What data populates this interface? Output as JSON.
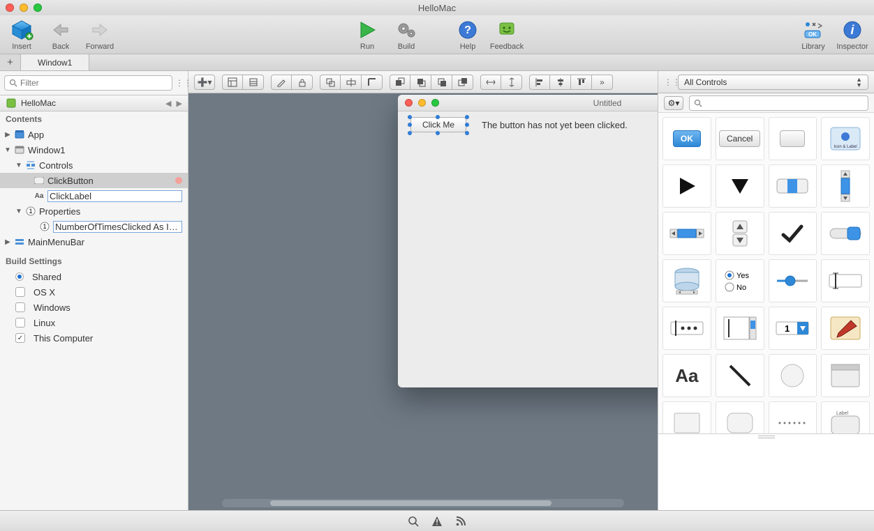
{
  "window": {
    "title": "HelloMac"
  },
  "toolbar": {
    "insert": "Insert",
    "back": "Back",
    "forward": "Forward",
    "run": "Run",
    "build": "Build",
    "help": "Help",
    "feedback": "Feedback",
    "library": "Library",
    "inspector": "Inspector"
  },
  "tabs": {
    "active": "Window1"
  },
  "navigator": {
    "filter_placeholder": "Filter",
    "project": "HelloMac",
    "contents_label": "Contents",
    "tree": {
      "app": "App",
      "window1": "Window1",
      "controls": "Controls",
      "click_button": "ClickButton",
      "click_label": "ClickLabel",
      "properties": "Properties",
      "prop1": "NumberOfTimesClicked As In...",
      "mainmenubar": "MainMenuBar"
    },
    "build_settings_label": "Build Settings",
    "build": {
      "shared": "Shared",
      "osx": "OS X",
      "windows": "Windows",
      "linux": "Linux",
      "this_computer": "This Computer"
    }
  },
  "canvas": {
    "window_title": "Untitled",
    "button_label": "Click Me",
    "label_text": "The button has not yet been clicked."
  },
  "library": {
    "selector": "All Controls",
    "search_placeholder": "",
    "items": {
      "ok": "OK",
      "cancel": "Cancel",
      "yes": "Yes",
      "no": "No",
      "aa": "Aa",
      "one": "1",
      "label": "Label",
      "iconlabel": "Icon & Label"
    }
  }
}
